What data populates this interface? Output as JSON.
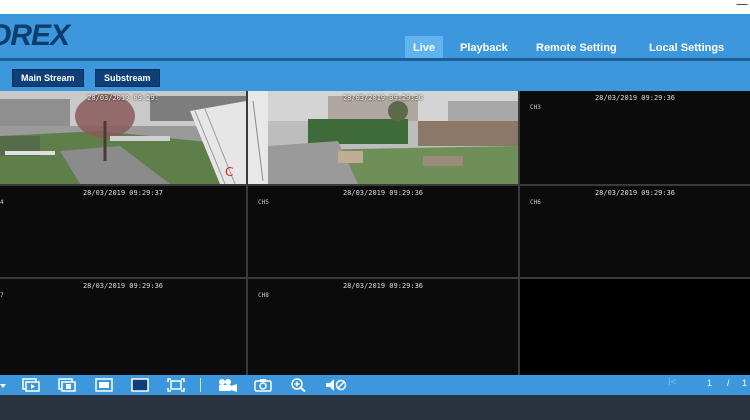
{
  "window": {
    "minimize_glyph": "—"
  },
  "header": {
    "logo": "OREX",
    "nav": [
      {
        "label": "Live",
        "active": true
      },
      {
        "label": "Playback",
        "active": false
      },
      {
        "label": "Remote Setting",
        "active": false
      },
      {
        "label": "Local Settings",
        "active": false
      }
    ]
  },
  "streams": {
    "main": "Main Stream",
    "sub": "Substream"
  },
  "channels": [
    {
      "timestamp": "28/03/2019 09:29:",
      "label": "",
      "has_video": true
    },
    {
      "timestamp": "28/03/2019 09:29:36",
      "label": "",
      "has_video": true
    },
    {
      "timestamp": "28/03/2019 09:29:36",
      "label": "CH3",
      "has_video": false
    },
    {
      "timestamp": "28/03/2019 09:29:37",
      "label": "4",
      "has_video": false
    },
    {
      "timestamp": "28/03/2019 09:29:36",
      "label": "CH5",
      "has_video": false
    },
    {
      "timestamp": "28/03/2019 09:29:36",
      "label": "CH6",
      "has_video": false
    },
    {
      "timestamp": "28/03/2019 09:29:36",
      "label": "7",
      "has_video": false
    },
    {
      "timestamp": "28/03/2019 09:29:36",
      "label": "CH8",
      "has_video": false
    },
    {
      "timestamp": "",
      "label": "",
      "has_video": false
    }
  ],
  "toolbar": {
    "icons": [
      "dropdown-arrow-icon",
      "play-all-icon",
      "stop-all-icon",
      "single-view-icon",
      "fullscreen-view-icon",
      "fit-window-icon",
      "record-icon",
      "snapshot-icon",
      "zoom-in-icon",
      "mute-icon"
    ],
    "pager": {
      "prev": "I<",
      "current": "1",
      "separator": "/",
      "total": "1"
    }
  },
  "colors": {
    "header": "#3d97dd",
    "stream_button": "#0e3f78",
    "active_tab": "#5fb4ef",
    "logo": "#0d3c6e"
  }
}
